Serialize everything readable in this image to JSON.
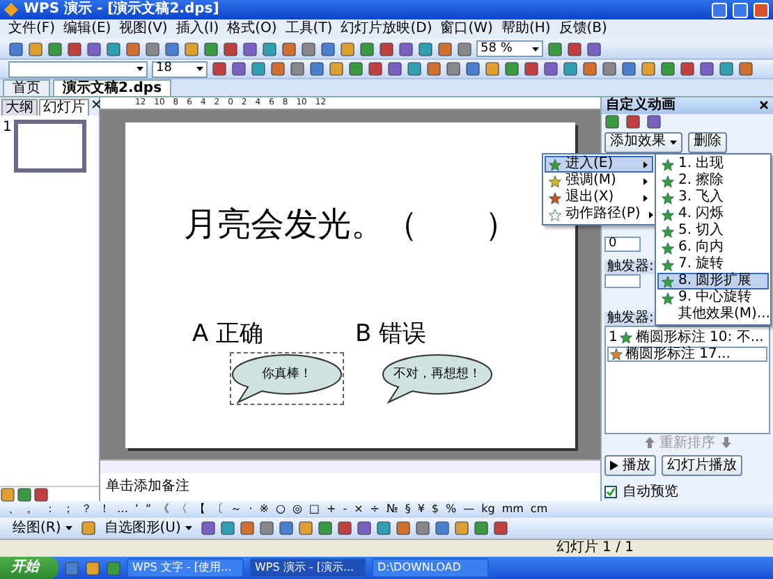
{
  "window": {
    "title": "WPS 演示 - [演示文稿2.dps]"
  },
  "menu_bar": [
    "文件(F)",
    "编辑(E)",
    "视图(V)",
    "插入(I)",
    "格式(O)",
    "工具(T)",
    "幻灯片放映(D)",
    "窗口(W)",
    "帮助(H)",
    "反馈(B)"
  ],
  "formatting_toolbar": {
    "font_size": "18",
    "zoom": "58 %"
  },
  "doc_tabs": [
    {
      "label": "首页",
      "selected": false
    },
    {
      "label": "演示文稿2.dps",
      "selected": true
    }
  ],
  "left_panel": {
    "tabs": [
      {
        "label": "大纲",
        "selected": false
      },
      {
        "label": "幻灯片",
        "selected": true
      }
    ],
    "close": "×",
    "slides": [
      {
        "number": "1",
        "selected": true
      }
    ]
  },
  "ruler_labels": [
    "12",
    "10",
    "8",
    "6",
    "4",
    "2",
    "0",
    "2",
    "4",
    "6",
    "8",
    "10",
    "12"
  ],
  "slide": {
    "question": "月亮会发光。（　　）",
    "options": [
      "A 正确",
      "B 错误"
    ],
    "callouts": [
      {
        "text": "你真棒！",
        "selected": true
      },
      {
        "text": "不对，再想想！",
        "selected": false
      }
    ]
  },
  "notes": {
    "placeholder": "单击添加备注"
  },
  "task_pane": {
    "title": "自定义动画",
    "add_effect": "添加效果",
    "remove": "删除",
    "field_value": "0",
    "triggers": [
      "触发器:",
      "触发器:"
    ],
    "list": [
      {
        "number": "1",
        "label": "椭圆形标注 10: 不...",
        "selected": false
      },
      {
        "label": "椭圆形标注 17...",
        "selected": true
      }
    ],
    "reorder": "重新排序",
    "play": "播放",
    "slideshow": "幻灯片播放",
    "autopreview": {
      "label": "自动预览",
      "checked": true
    }
  },
  "effect_menu": [
    {
      "label": "进入(E)",
      "selected": true
    },
    {
      "label": "强调(M)",
      "selected": false
    },
    {
      "label": "退出(X)",
      "selected": false
    },
    {
      "label": "动作路径(P)",
      "selected": false
    }
  ],
  "effect_submenu": [
    {
      "label": "1. 出现",
      "selected": false
    },
    {
      "label": "2. 擦除",
      "selected": false
    },
    {
      "label": "3. 飞入",
      "selected": false
    },
    {
      "label": "4. 闪烁",
      "selected": false
    },
    {
      "label": "5. 切入",
      "selected": false
    },
    {
      "label": "6. 向内",
      "selected": false
    },
    {
      "label": "7. 旋转",
      "selected": false
    },
    {
      "label": "8. 圆形扩展",
      "selected": true
    },
    {
      "label": "9. 中心旋转",
      "selected": false
    },
    {
      "label": "其他效果(M)...",
      "selected": false
    }
  ],
  "symbols": [
    "、",
    "。",
    "：",
    "；",
    "？",
    "！",
    "…",
    "‘",
    "“",
    "《",
    "〈",
    "【",
    "〔",
    "～",
    "·",
    "※",
    "○",
    "◎",
    "□",
    "+",
    "-",
    "×",
    "÷",
    "№",
    "§",
    "¥",
    "$",
    "%",
    "—",
    "kg",
    "mm",
    "cm"
  ],
  "drawing_toolbar": {
    "draw": "绘图(R)",
    "autoshapes": "自选图形(U)"
  },
  "status_bar": {
    "slide": "幻灯片 1 / 1"
  },
  "taskbar": {
    "start": "开始",
    "tasks": [
      {
        "label": "WPS 文字 - [使用...",
        "selected": false
      },
      {
        "label": "WPS 演示 - [演示...",
        "selected": true
      },
      {
        "label": "D:\\DOWNLOAD",
        "selected": false
      }
    ]
  }
}
